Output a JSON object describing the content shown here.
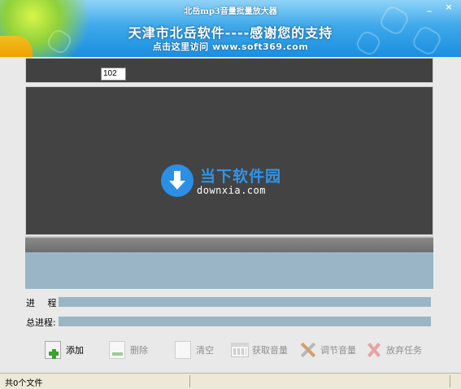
{
  "window": {
    "title": "北岳mp3音量批量放大器",
    "minimize_glyph": "_",
    "close_glyph": "×"
  },
  "banner": {
    "line1": "天津市北岳软件----感谢您的支持",
    "line2": "点击这里访问 www.soft369.com"
  },
  "volume_value": "102",
  "watermark": {
    "name": "当下软件园",
    "url": "downxia.com"
  },
  "progress": {
    "label": "进 程:",
    "value": 0
  },
  "total_progress": {
    "label": "总进程:",
    "value": 0
  },
  "toolbar": {
    "add": "添加",
    "delete": "删除",
    "clear": "清空",
    "get_volume": "获取音量",
    "adjust_volume": "调节音量",
    "abort_task": "放弃任务"
  },
  "status": {
    "file_count_text": "共0个文件"
  },
  "colors": {
    "banner_blue": "#1a8ee0",
    "progress_track": "#9ab6c6",
    "list_background": "#434343"
  }
}
